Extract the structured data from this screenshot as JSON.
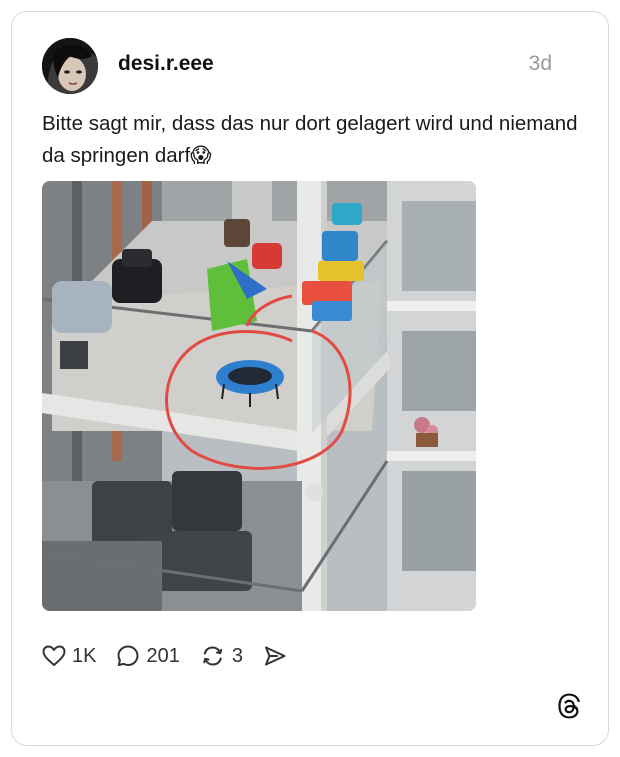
{
  "post": {
    "username": "desi.r.eee",
    "time": "3d",
    "text": "Bitte sagt mir, dass das nur dort gelagert wird und niemand da springen darf😱"
  },
  "actions": {
    "likes": "1K",
    "replies": "201",
    "reposts": "3"
  },
  "icons": [
    "heart-icon",
    "comment-icon",
    "repost-icon",
    "share-icon",
    "threads-logo-icon"
  ],
  "colors": {
    "username": "#111111",
    "time": "#999999",
    "card_border": "#d9d9d9",
    "circle_annotation": "#e24a43",
    "trampoline": "#2f7fcf"
  }
}
